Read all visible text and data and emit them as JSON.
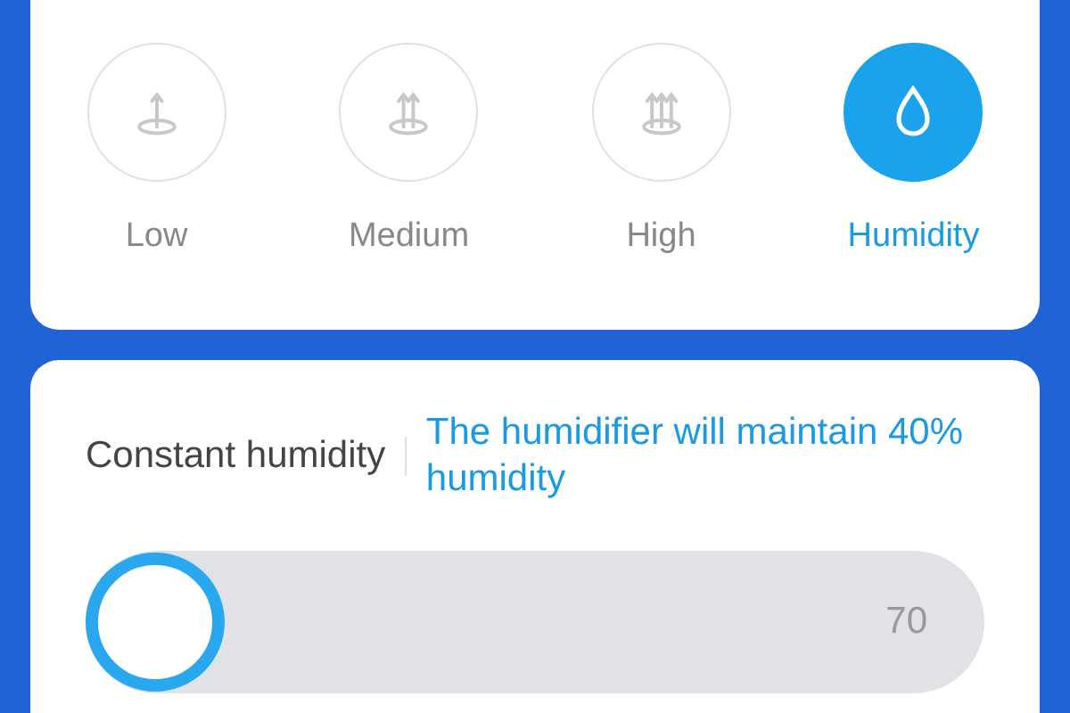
{
  "modes": [
    {
      "label": "Low",
      "kind": "speed",
      "selected": false
    },
    {
      "label": "Medium",
      "kind": "speed",
      "selected": false
    },
    {
      "label": "High",
      "kind": "speed",
      "selected": false
    },
    {
      "label": "Humidity",
      "kind": "drop",
      "selected": true
    }
  ],
  "constant_humidity": {
    "title": "Constant humidity",
    "description": "The humidifier will maintain 40% humidity",
    "slider": {
      "level": 0,
      "reading": "70"
    }
  }
}
